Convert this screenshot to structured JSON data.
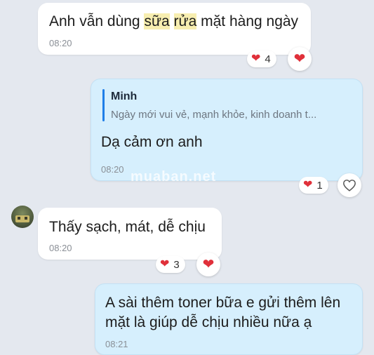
{
  "messages": [
    {
      "text_parts": [
        "Anh vẫn dùng ",
        "sữa",
        " ",
        "rửa",
        " mặt hàng ngày"
      ],
      "time": "08:20",
      "reaction_count": "4"
    },
    {
      "reply": {
        "name": "Minh",
        "preview": "Ngày mới vui vẻ, mạnh khỏe, kinh doanh t..."
      },
      "text": "Dạ cảm ơn anh",
      "time": "08:20",
      "reaction_count": "1"
    },
    {
      "text": "Thấy sạch, mát, dễ chịu",
      "time": "08:20",
      "reaction_count": "3"
    },
    {
      "text_line1": "A sài thêm toner bữa e gửi thêm lên",
      "text_line2": "mặt là giúp dễ chịu nhiều nữa ạ",
      "time": "08:21"
    }
  ],
  "watermark": "muaban.net",
  "colors": {
    "background": "#e4e8ef",
    "incoming_bubble": "#ffffff",
    "outgoing_bubble": "#d6effd",
    "heart": "#e0303a",
    "reply_accent": "#1e7ee8"
  }
}
